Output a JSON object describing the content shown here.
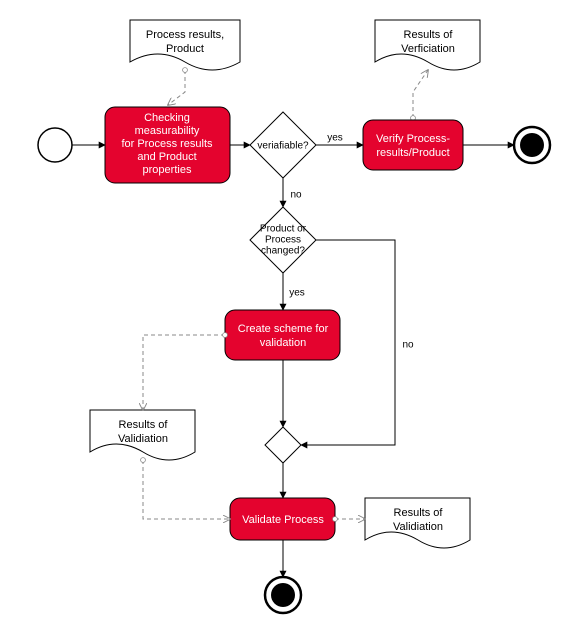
{
  "tasks": {
    "check": {
      "l1": "Checking",
      "l2": "measurability",
      "l3": "for Process results",
      "l4": "and Product",
      "l5": "properties"
    },
    "verify": {
      "l1": "Verify Process-",
      "l2": "results/Product"
    },
    "scheme": {
      "l1": "Create scheme for",
      "l2": "validation"
    },
    "validate": {
      "l1": "Validate Process"
    }
  },
  "docs": {
    "input": {
      "l1": "Process results,",
      "l2": "Product"
    },
    "verif": {
      "l1": "Results of",
      "l2": "Verficiation"
    },
    "valid1": {
      "l1": "Results of",
      "l2": "Validiation"
    },
    "valid2": {
      "l1": "Results of",
      "l2": "Validiation"
    }
  },
  "gateways": {
    "verifiable": "veriafiable?",
    "changed": {
      "l1": "Product or",
      "l2": "Process",
      "l3": "changed?"
    }
  },
  "edges": {
    "yes1": "yes",
    "no1": "no",
    "yes2": "yes",
    "no2": "no"
  }
}
